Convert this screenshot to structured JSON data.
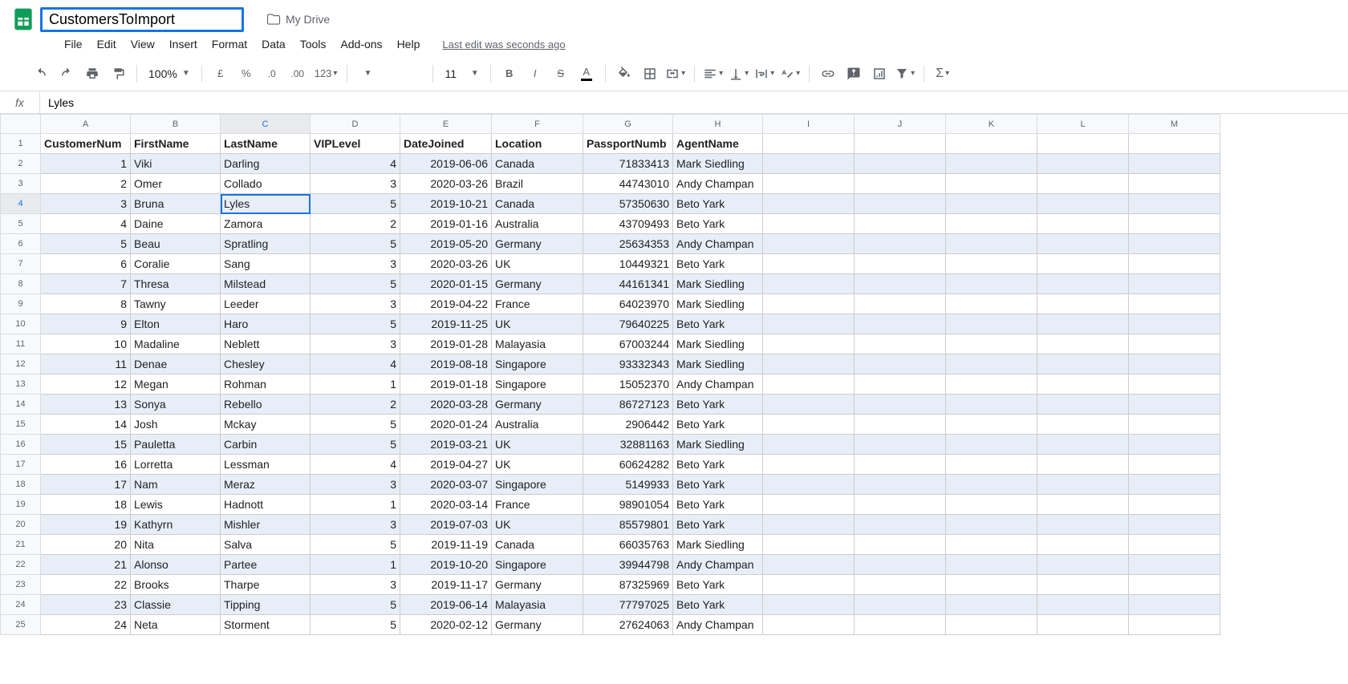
{
  "doc": {
    "title": "CustomersToImport",
    "drive_loc": "My Drive",
    "last_edit": "Last edit was seconds ago"
  },
  "menus": [
    "File",
    "Edit",
    "View",
    "Insert",
    "Format",
    "Data",
    "Tools",
    "Add-ons",
    "Help"
  ],
  "toolbar": {
    "zoom": "100%",
    "currency": "£",
    "percent": "%",
    "dec_minus": ".0",
    "dec_plus": ".00",
    "num_fmt": "123",
    "font_name": "",
    "font_size": "11"
  },
  "formula": {
    "fx": "fx",
    "value": "Lyles"
  },
  "active_cell": {
    "row": 4,
    "col": "C"
  },
  "col_letters": [
    "A",
    "B",
    "C",
    "D",
    "E",
    "F",
    "G",
    "H",
    "I",
    "J",
    "K",
    "L",
    "M"
  ],
  "headers": [
    "CustomerNum",
    "FirstName",
    "LastName",
    "VIPLevel",
    "DateJoined",
    "Location",
    "PassportNumb",
    "AgentName"
  ],
  "rows": [
    {
      "n": 1,
      "fn": "Viki",
      "ln": "Darling",
      "vip": 4,
      "dj": "2019-06-06",
      "loc": "Canada",
      "pp": 71833413,
      "ag": "Mark Siedling"
    },
    {
      "n": 2,
      "fn": "Omer",
      "ln": "Collado",
      "vip": 3,
      "dj": "2020-03-26",
      "loc": "Brazil",
      "pp": 44743010,
      "ag": "Andy Champan"
    },
    {
      "n": 3,
      "fn": "Bruna",
      "ln": "Lyles",
      "vip": 5,
      "dj": "2019-10-21",
      "loc": "Canada",
      "pp": 57350630,
      "ag": "Beto Yark"
    },
    {
      "n": 4,
      "fn": "Daine",
      "ln": "Zamora",
      "vip": 2,
      "dj": "2019-01-16",
      "loc": "Australia",
      "pp": 43709493,
      "ag": "Beto Yark"
    },
    {
      "n": 5,
      "fn": "Beau",
      "ln": "Spratling",
      "vip": 5,
      "dj": "2019-05-20",
      "loc": "Germany",
      "pp": 25634353,
      "ag": "Andy Champan"
    },
    {
      "n": 6,
      "fn": "Coralie",
      "ln": "Sang",
      "vip": 3,
      "dj": "2020-03-26",
      "loc": "UK",
      "pp": 10449321,
      "ag": "Beto Yark"
    },
    {
      "n": 7,
      "fn": "Thresa",
      "ln": "Milstead",
      "vip": 5,
      "dj": "2020-01-15",
      "loc": "Germany",
      "pp": 44161341,
      "ag": "Mark Siedling"
    },
    {
      "n": 8,
      "fn": "Tawny",
      "ln": "Leeder",
      "vip": 3,
      "dj": "2019-04-22",
      "loc": "France",
      "pp": 64023970,
      "ag": "Mark Siedling"
    },
    {
      "n": 9,
      "fn": "Elton",
      "ln": "Haro",
      "vip": 5,
      "dj": "2019-11-25",
      "loc": "UK",
      "pp": 79640225,
      "ag": "Beto Yark"
    },
    {
      "n": 10,
      "fn": "Madaline",
      "ln": "Neblett",
      "vip": 3,
      "dj": "2019-01-28",
      "loc": "Malayasia",
      "pp": 67003244,
      "ag": "Mark Siedling"
    },
    {
      "n": 11,
      "fn": "Denae",
      "ln": "Chesley",
      "vip": 4,
      "dj": "2019-08-18",
      "loc": "Singapore",
      "pp": 93332343,
      "ag": "Mark Siedling"
    },
    {
      "n": 12,
      "fn": "Megan",
      "ln": "Rohman",
      "vip": 1,
      "dj": "2019-01-18",
      "loc": "Singapore",
      "pp": 15052370,
      "ag": "Andy Champan"
    },
    {
      "n": 13,
      "fn": "Sonya",
      "ln": "Rebello",
      "vip": 2,
      "dj": "2020-03-28",
      "loc": "Germany",
      "pp": 86727123,
      "ag": "Beto Yark"
    },
    {
      "n": 14,
      "fn": "Josh",
      "ln": "Mckay",
      "vip": 5,
      "dj": "2020-01-24",
      "loc": "Australia",
      "pp": 2906442,
      "ag": "Beto Yark"
    },
    {
      "n": 15,
      "fn": "Pauletta",
      "ln": "Carbin",
      "vip": 5,
      "dj": "2019-03-21",
      "loc": "UK",
      "pp": 32881163,
      "ag": "Mark Siedling"
    },
    {
      "n": 16,
      "fn": "Lorretta",
      "ln": "Lessman",
      "vip": 4,
      "dj": "2019-04-27",
      "loc": "UK",
      "pp": 60624282,
      "ag": "Beto Yark"
    },
    {
      "n": 17,
      "fn": "Nam",
      "ln": "Meraz",
      "vip": 3,
      "dj": "2020-03-07",
      "loc": "Singapore",
      "pp": 5149933,
      "ag": "Beto Yark"
    },
    {
      "n": 18,
      "fn": "Lewis",
      "ln": "Hadnott",
      "vip": 1,
      "dj": "2020-03-14",
      "loc": "France",
      "pp": 98901054,
      "ag": "Beto Yark"
    },
    {
      "n": 19,
      "fn": "Kathyrn",
      "ln": "Mishler",
      "vip": 3,
      "dj": "2019-07-03",
      "loc": "UK",
      "pp": 85579801,
      "ag": "Beto Yark"
    },
    {
      "n": 20,
      "fn": "Nita",
      "ln": "Salva",
      "vip": 5,
      "dj": "2019-11-19",
      "loc": "Canada",
      "pp": 66035763,
      "ag": "Mark Siedling"
    },
    {
      "n": 21,
      "fn": "Alonso",
      "ln": "Partee",
      "vip": 1,
      "dj": "2019-10-20",
      "loc": "Singapore",
      "pp": 39944798,
      "ag": "Andy Champan"
    },
    {
      "n": 22,
      "fn": "Brooks",
      "ln": "Tharpe",
      "vip": 3,
      "dj": "2019-11-17",
      "loc": "Germany",
      "pp": 87325969,
      "ag": "Beto Yark"
    },
    {
      "n": 23,
      "fn": "Classie",
      "ln": "Tipping",
      "vip": 5,
      "dj": "2019-06-14",
      "loc": "Malayasia",
      "pp": 77797025,
      "ag": "Beto Yark"
    },
    {
      "n": 24,
      "fn": "Neta",
      "ln": "Storment",
      "vip": 5,
      "dj": "2020-02-12",
      "loc": "Germany",
      "pp": 27624063,
      "ag": "Andy Champan"
    }
  ]
}
